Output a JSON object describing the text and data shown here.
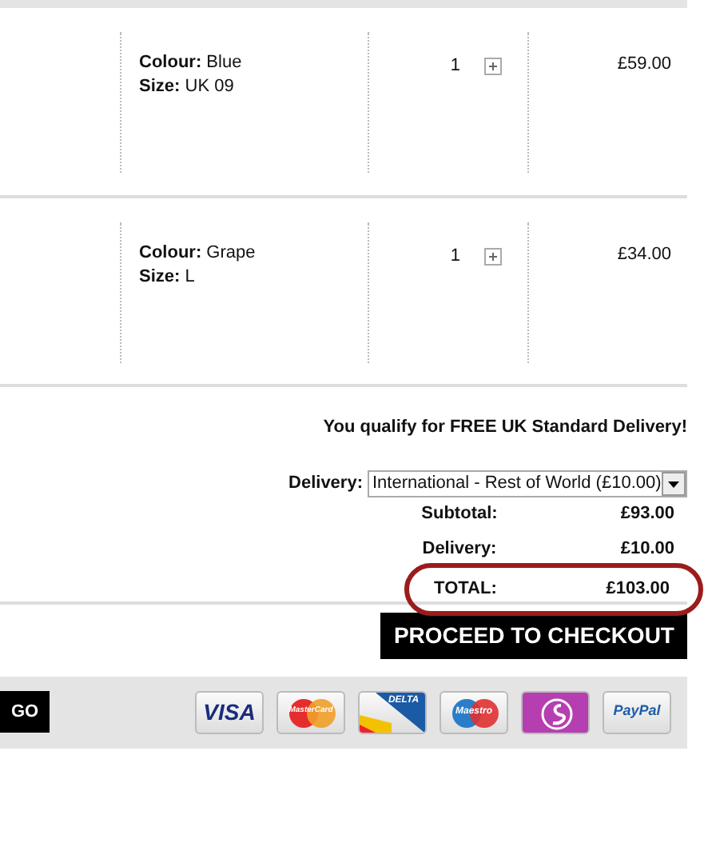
{
  "items": [
    {
      "colour_label": "Colour:",
      "colour": "Blue",
      "size_label": "Size:",
      "size": "UK 09",
      "quantity": "1",
      "price": "£59.00"
    },
    {
      "colour_label": "Colour:",
      "colour": "Grape",
      "size_label": "Size:",
      "size": "L",
      "quantity": "1",
      "price": "£34.00"
    }
  ],
  "free_delivery_message": "You qualify for FREE UK Standard Delivery!",
  "delivery_select": {
    "label": "Delivery:",
    "value": "International - Rest of World (£10.00)"
  },
  "totals": [
    {
      "label": "Subtotal:",
      "value": "£93.00",
      "highlighted": false
    },
    {
      "label": "Delivery:",
      "value": "£10.00",
      "highlighted": false
    },
    {
      "label": "TOTAL:",
      "value": "£103.00",
      "highlighted": true
    }
  ],
  "checkout_button": "PROCEED TO CHECKOUT",
  "go_button": "GO",
  "payment_cards": [
    {
      "kind": "visa",
      "text": "VISA"
    },
    {
      "kind": "mastercard",
      "text": "MasterCard"
    },
    {
      "kind": "delta",
      "text": "DELTA"
    },
    {
      "kind": "maestro",
      "text": "Maestro"
    },
    {
      "kind": "solo"
    },
    {
      "kind": "paypal",
      "text": "PayPal"
    }
  ]
}
